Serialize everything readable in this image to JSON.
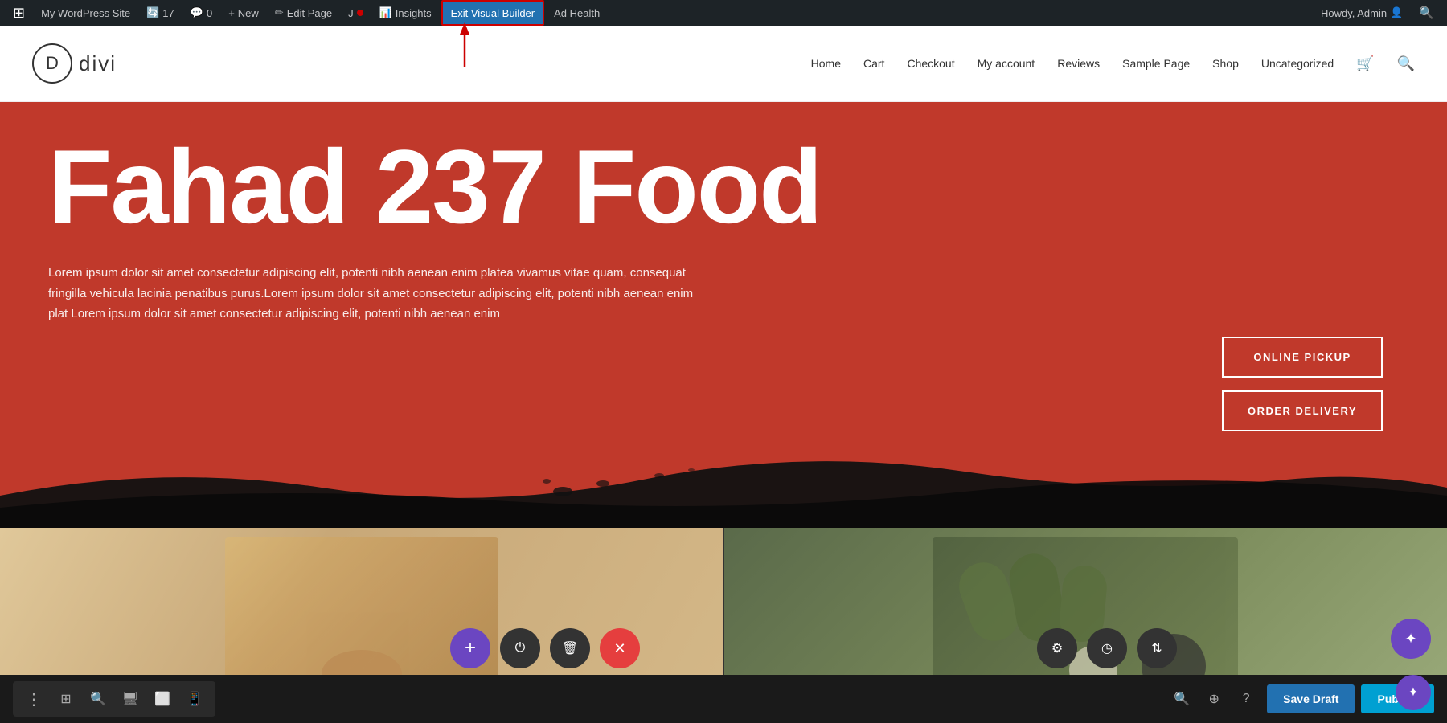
{
  "admin_bar": {
    "wp_logo": "W",
    "site_name": "My WordPress Site",
    "updates_count": "17",
    "comments_count": "0",
    "new_label": "New",
    "edit_page_label": "Edit Page",
    "jetpack_label": "J",
    "insights_label": "Insights",
    "exit_vb_label": "Exit Visual Builder",
    "ad_health_label": "Ad Health",
    "howdy_label": "Howdy, Admin"
  },
  "site_nav": {
    "logo_d": "D",
    "logo_name": "divi",
    "items": [
      "Home",
      "Cart",
      "Checkout",
      "My account",
      "Reviews",
      "Sample Page",
      "Shop",
      "Uncategorized"
    ]
  },
  "hero": {
    "title": "Fahad 237 Food",
    "subtitle": "Lorem ipsum dolor sit amet consectetur adipiscing elit, potenti nibh aenean enim platea vivamus vitae quam, consequat fringilla vehicula lacinia penatibus purus.Lorem ipsum dolor sit amet consectetur adipiscing elit, potenti nibh aenean enim plat Lorem ipsum dolor sit amet consectetur adipiscing elit, potenti nibh aenean enim",
    "btn_pickup": "ONLINE PICKUP",
    "btn_delivery": "ORDER DELIVERY"
  },
  "toolbar": {
    "save_draft_label": "Save Draft",
    "publish_label": "Publish"
  },
  "icons": {
    "plus": "+",
    "power": "⏻",
    "trash": "🗑",
    "close": "✕",
    "gear": "⚙",
    "history": "◷",
    "arrows": "⇅",
    "settings": "⚙",
    "layers": "☰",
    "search": "🔍",
    "search2": "🔎",
    "display": "▣",
    "phone": "📱",
    "tablet": "⬜",
    "dots": "⋮"
  }
}
